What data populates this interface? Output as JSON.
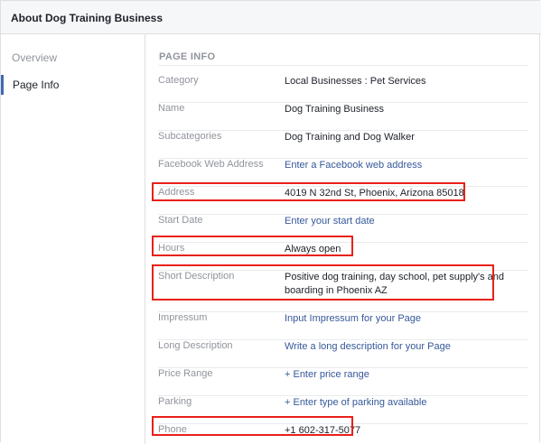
{
  "header": {
    "title": "About Dog Training Business"
  },
  "sidebar": {
    "items": [
      {
        "label": "Overview"
      },
      {
        "label": "Page Info"
      }
    ]
  },
  "main": {
    "section_title": "PAGE INFO",
    "rows": [
      {
        "label": "Category",
        "value": "Local Businesses : Pet Services"
      },
      {
        "label": "Name",
        "value": "Dog Training Business"
      },
      {
        "label": "Subcategories",
        "value": "Dog Training and Dog Walker"
      },
      {
        "label": "Facebook Web Address",
        "value": "Enter a Facebook web address"
      },
      {
        "label": "Address",
        "value": "4019 N 32nd St, Phoenix, Arizona 85018"
      },
      {
        "label": "Start Date",
        "value": "Enter your start date"
      },
      {
        "label": "Hours",
        "value": "Always open"
      },
      {
        "label": "Short Description",
        "value": "Positive dog training, day school, pet supply's and boarding in Phoenix AZ"
      },
      {
        "label": "Impressum",
        "value": "Input Impressum for your Page"
      },
      {
        "label": "Long Description",
        "value": "Write a long description for your Page"
      },
      {
        "label": "Price Range",
        "value": "+ Enter price range"
      },
      {
        "label": "Parking",
        "value": "+ Enter type of parking available"
      },
      {
        "label": "Phone",
        "value": "+1 602-317-5077"
      }
    ]
  },
  "colors": {
    "link": "#365899",
    "label": "#90949c",
    "highlight": "#e8211a",
    "active_nav": "#4267b2"
  }
}
